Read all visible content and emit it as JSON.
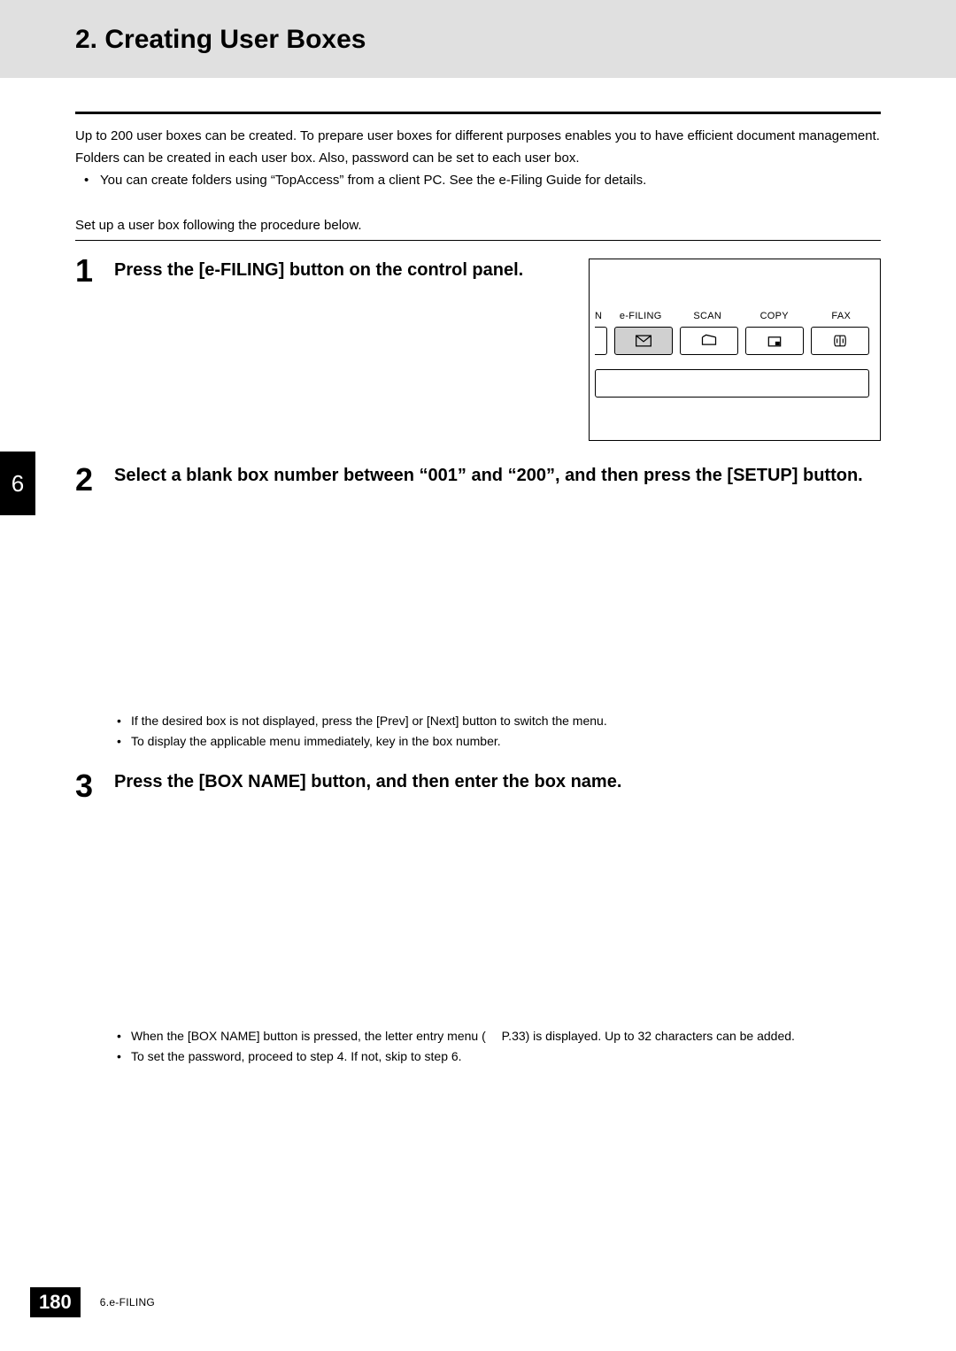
{
  "header": {
    "title": "2. Creating User Boxes"
  },
  "intro": {
    "p1": "Up to 200 user boxes can be created. To prepare user boxes for different purposes enables you to have efficient document management.",
    "p2": "Folders can be created in each user box. Also, password can be set to each user box.",
    "bullet1": "You can create folders using “TopAccess” from a client PC. See the e-Filing Guide for details."
  },
  "setup_line": "Set up a user box following the procedure below.",
  "steps": {
    "s1": {
      "num": "1",
      "title": "Press the [e-FILING] button on the control panel."
    },
    "s2": {
      "num": "2",
      "title": "Select a blank box number between “001” and “200”, and then press the [SETUP] button.",
      "b1": "If the desired box is not displayed, press the [Prev] or [Next] button to switch the menu.",
      "b2": "To display the applicable menu immediately, key in the box number."
    },
    "s3": {
      "num": "3",
      "title": "Press the [BOX NAME] button, and then enter the box name.",
      "b1a": "When the [BOX NAME] button is pressed, the letter entry menu (",
      "b1page": " P.33)",
      "b1b": " is displayed. Up to 32 characters can be added.",
      "b2": "To set the password, proceed to step 4. If not, skip to step 6."
    }
  },
  "panel": {
    "n": "N",
    "efiling": "e-FILING",
    "scan": "SCAN",
    "copy": "COPY",
    "fax": "FAX"
  },
  "chapter_tab": "6",
  "footer": {
    "page": "180",
    "text": "6.e-FILING"
  }
}
